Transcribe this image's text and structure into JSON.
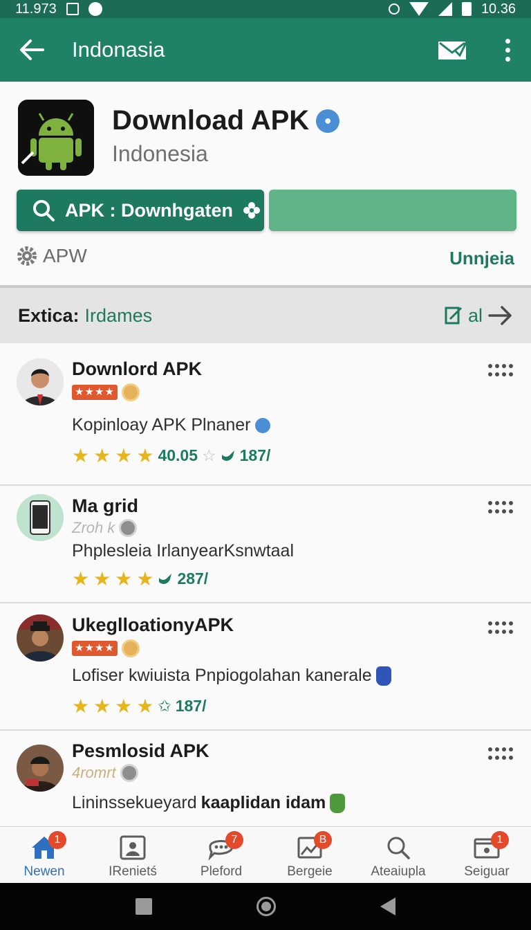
{
  "status_bar": {
    "time_left": "11.973",
    "time_right": "10.36"
  },
  "app_bar": {
    "title": "Indonasia"
  },
  "header": {
    "title": "Download APK",
    "subtitle": "Indonesia",
    "primary_button": "APK : Downhgaten",
    "meta_label": "APW",
    "link_label": "Unnjeia"
  },
  "section": {
    "title": "Extica:",
    "accent": "Irdames",
    "action_label": "al"
  },
  "list": [
    {
      "title": "Downlord APK",
      "meta": "",
      "desc": "Kopinloay APK Plnaner",
      "desc_bold": "",
      "stats": [
        "40.05",
        "187/"
      ]
    },
    {
      "title": "Ma grid",
      "meta": "Zroh k",
      "desc": "Phplesleia IrlanyearKsnwtaal",
      "desc_bold": "",
      "stats": [
        "287/"
      ]
    },
    {
      "title": "UkeglloationyAPK",
      "meta": "",
      "desc": "Lofiser kwiuista Pnpiogolahan kanerale",
      "desc_bold": "",
      "stats": [
        "187/"
      ]
    },
    {
      "title": "Pesmlosid APK",
      "meta": "4romrt",
      "desc": "Lininssekueyard",
      "desc_bold": "kaaplidan idam",
      "stats": []
    }
  ],
  "bottom_nav": [
    {
      "label": "Newen",
      "badge": "1",
      "active": true
    },
    {
      "label": "IRenietś",
      "badge": "",
      "active": false
    },
    {
      "label": "Pleford",
      "badge": "7",
      "active": false
    },
    {
      "label": "Bergeie",
      "badge": "B",
      "active": false
    },
    {
      "label": "Ateaiupla",
      "badge": "",
      "active": false
    },
    {
      "label": "Seiguar",
      "badge": "1",
      "active": false
    }
  ],
  "colors": {
    "accent": "#1f8166",
    "accent_dark": "#1d7a60",
    "accent_light": "#5fb387",
    "badge": "#e24a2b",
    "active_nav": "#2f6fc0"
  },
  "icons": {
    "app_bar": [
      "back-arrow-icon",
      "mail-check-icon",
      "more-vert-icon"
    ],
    "bottom_nav": [
      "home-icon",
      "contact-card-icon",
      "chat-bubble-icon",
      "image-chart-icon",
      "search-icon",
      "wallet-icon"
    ]
  }
}
